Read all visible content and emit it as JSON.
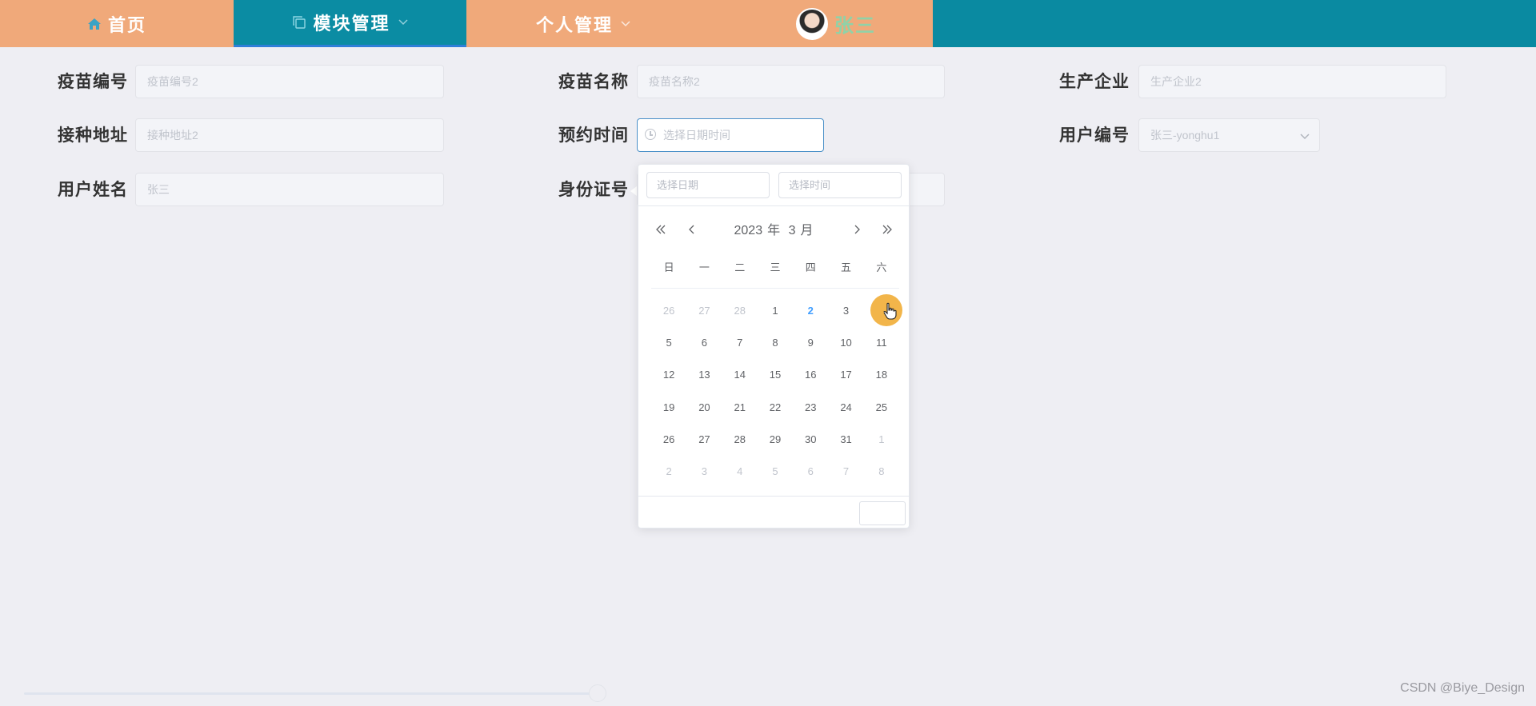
{
  "nav": {
    "home_label": "首页",
    "module_label": "模块管理",
    "personal_label": "个人管理",
    "user_name": "张三"
  },
  "form": {
    "vaccine_no": {
      "label": "疫苗编号",
      "placeholder": "疫苗编号2"
    },
    "vaccine_name": {
      "label": "疫苗名称",
      "placeholder": "疫苗名称2"
    },
    "manufacturer": {
      "label": "生产企业",
      "placeholder": "生产企业2"
    },
    "address": {
      "label": "接种地址",
      "placeholder": "接种地址2"
    },
    "appointment_time": {
      "label": "预约时间",
      "placeholder": "选择日期时间"
    },
    "user_no": {
      "label": "用户编号",
      "placeholder": "张三-yonghu1"
    },
    "user_name": {
      "label": "用户姓名",
      "placeholder": "张三"
    },
    "id_card": {
      "label": "身份证号",
      "placeholder": ""
    }
  },
  "datepicker": {
    "date_placeholder": "选择日期",
    "time_placeholder": "选择时间",
    "year": "2023",
    "year_unit": "年",
    "month": "3",
    "month_unit": "月",
    "weekdays": [
      "日",
      "一",
      "二",
      "三",
      "四",
      "五",
      "六"
    ],
    "weeks": [
      [
        "26",
        "27",
        "28",
        "1",
        "2",
        "3",
        "4"
      ],
      [
        "5",
        "6",
        "7",
        "8",
        "9",
        "10",
        "11"
      ],
      [
        "12",
        "13",
        "14",
        "15",
        "16",
        "17",
        "18"
      ],
      [
        "19",
        "20",
        "21",
        "22",
        "23",
        "24",
        "25"
      ],
      [
        "26",
        "27",
        "28",
        "29",
        "30",
        "31",
        "1"
      ],
      [
        "2",
        "3",
        "4",
        "5",
        "6",
        "7",
        "8"
      ]
    ],
    "other_month": [
      [
        true,
        true,
        true,
        false,
        false,
        false,
        false
      ],
      [
        false,
        false,
        false,
        false,
        false,
        false,
        false
      ],
      [
        false,
        false,
        false,
        false,
        false,
        false,
        false
      ],
      [
        false,
        false,
        false,
        false,
        false,
        false,
        false
      ],
      [
        false,
        false,
        false,
        false,
        false,
        false,
        true
      ],
      [
        true,
        true,
        true,
        true,
        true,
        true,
        true
      ]
    ],
    "today": "2",
    "hovered": "4"
  },
  "colors": {
    "nav_orange": "#f0a97a",
    "nav_teal": "#0a8aa1",
    "hover_highlight": "#f2b54a",
    "today_blue": "#409eff"
  },
  "watermark": "CSDN @Biye_Design"
}
